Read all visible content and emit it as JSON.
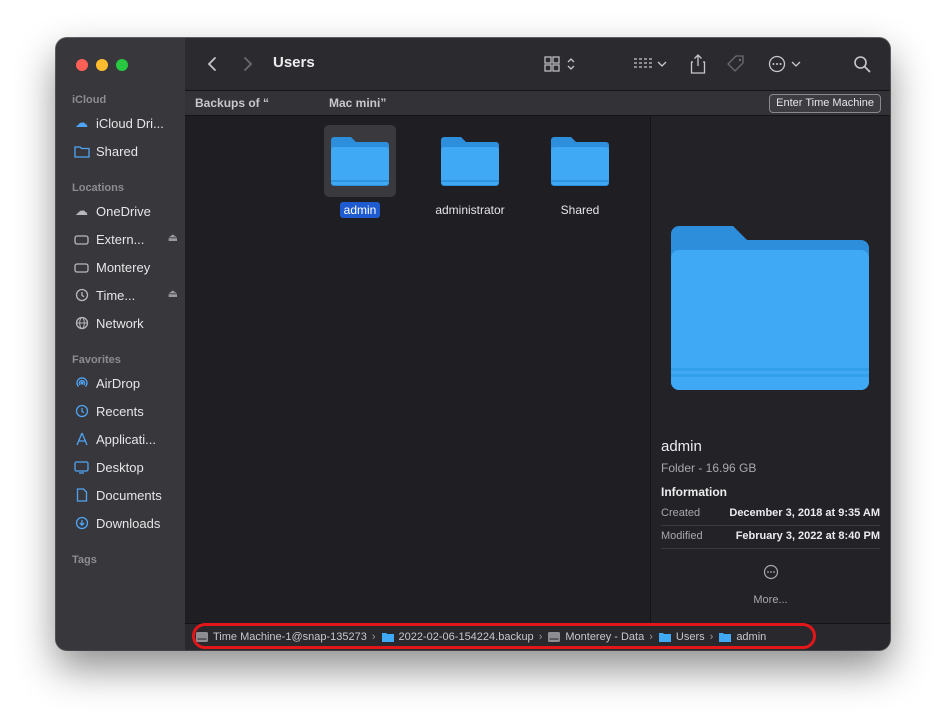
{
  "window": {
    "title": "Users"
  },
  "sidebar": {
    "sections": [
      {
        "label": "iCloud",
        "items": [
          {
            "label": "iCloud Dri...",
            "icon": "cloud-icon"
          },
          {
            "label": "Shared",
            "icon": "shared-folder-icon"
          }
        ]
      },
      {
        "label": "Locations",
        "items": [
          {
            "label": "OneDrive",
            "icon": "cloud-icon"
          },
          {
            "label": "Extern...",
            "icon": "drive-icon"
          },
          {
            "label": "Monterey",
            "icon": "drive-icon"
          },
          {
            "label": "Time...",
            "icon": "time-machine-icon"
          },
          {
            "label": "Network",
            "icon": "globe-icon"
          }
        ]
      },
      {
        "label": "Favorites",
        "items": [
          {
            "label": "AirDrop",
            "icon": "airdrop-icon"
          },
          {
            "label": "Recents",
            "icon": "clock-icon"
          },
          {
            "label": "Applicati...",
            "icon": "applications-icon"
          },
          {
            "label": "Desktop",
            "icon": "desktop-icon"
          },
          {
            "label": "Documents",
            "icon": "document-icon"
          },
          {
            "label": "Downloads",
            "icon": "download-icon"
          }
        ]
      },
      {
        "label": "Tags",
        "items": []
      }
    ]
  },
  "time_machine_bar": {
    "left_label": "Backups of “",
    "right_label": "Mac mini”",
    "button_label": "Enter Time Machine"
  },
  "files": [
    {
      "name": "admin",
      "selected": true
    },
    {
      "name": "administrator",
      "selected": false
    },
    {
      "name": "Shared",
      "selected": false
    }
  ],
  "preview": {
    "name": "admin",
    "kind": "Folder - 16.96 GB",
    "info_heading": "Information",
    "rows": [
      {
        "key": "Created",
        "value": "December 3, 2018 at 9:35 AM"
      },
      {
        "key": "Modified",
        "value": "February 3, 2022 at 8:40 PM"
      }
    ],
    "more_label": "More..."
  },
  "path_bar": [
    {
      "label": "Time Machine-1@snap-135273",
      "icon": "drive-icon"
    },
    {
      "label": "2022-02-06-154224.backup",
      "icon": "folder-icon"
    },
    {
      "label": "Monterey - Data",
      "icon": "drive-icon"
    },
    {
      "label": "Users",
      "icon": "folder-icon"
    },
    {
      "label": "admin",
      "icon": "folder-icon"
    }
  ],
  "colors": {
    "accent": "#1e5bd0",
    "folder": "#3fa9f5",
    "highlight": "#e3161a"
  }
}
